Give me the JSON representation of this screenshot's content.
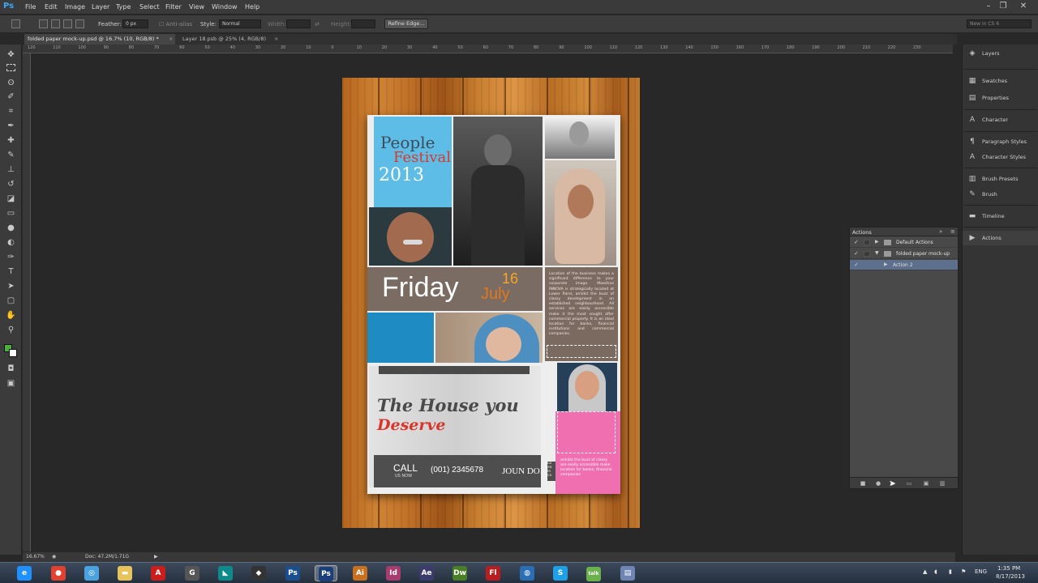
{
  "app": {
    "logo": "Ps"
  },
  "menubar": {
    "items": [
      "File",
      "Edit",
      "Image",
      "Layer",
      "Type",
      "Select",
      "Filter",
      "View",
      "Window",
      "Help"
    ],
    "window_controls": [
      "–",
      "❐",
      "✕"
    ]
  },
  "options_bar": {
    "feather_label": "Feather:",
    "feather_value": "0 px",
    "antialias_label": "Anti-alias",
    "style_label": "Style:",
    "style_value": "Normal",
    "width_label": "Width:",
    "height_label": "Height:",
    "refine_edge": "Refine Edge...",
    "workspace": "New in CS 6"
  },
  "tabs": [
    {
      "label": "folded paper mock-up.psd @ 16.7% (10, RGB/8) *",
      "active": true
    },
    {
      "label": "Layer 18.psb @ 25% (4, RGB/8)",
      "active": false
    }
  ],
  "ruler_h": [
    "120",
    "110",
    "100",
    "90",
    "80",
    "70",
    "60",
    "50",
    "40",
    "30",
    "20",
    "10",
    "0",
    "10",
    "20",
    "30",
    "40",
    "50",
    "60",
    "70",
    "80",
    "90",
    "100",
    "110",
    "120",
    "130",
    "140",
    "150",
    "160",
    "170",
    "180",
    "190",
    "200",
    "210",
    "220",
    "230"
  ],
  "flyer": {
    "people": "People",
    "festival": "Festival",
    "year": "2013",
    "day": "Friday",
    "date_num": "16",
    "month": "July",
    "body_text": "Location of the business makes a significant difference to your corporate image. Maestros INNOVA is strategically located at Lower Parel, amidst the buzz of classy development in an established neighbourhood. All services are easily accessible make it the most sought after commercial property. It is an ideal location for banks, financial institutions and commercial companies.",
    "pink_text": "amidst the buzz of classy are easily accessible make location for banks, financial companies",
    "house_line1": "The House you",
    "house_line2": "Deserve",
    "call": "CALL",
    "call_sub": "US NOW",
    "phone": "(001) 2345678",
    "name": "JOUN DOE",
    "side_text": "Lo ea lo co"
  },
  "status": {
    "zoom": "16.67%",
    "doc": "Doc: 47.2M/1.71G"
  },
  "dock": [
    {
      "icon": "layers-icon",
      "glyph": "◈",
      "label": "Layers"
    },
    {
      "icon": "swatches-icon",
      "glyph": "▦",
      "label": "Swatches"
    },
    {
      "icon": "properties-icon",
      "glyph": "▤",
      "label": "Properties"
    },
    {
      "icon": "character-icon",
      "glyph": "A",
      "label": "Character"
    },
    {
      "icon": "paragraph-styles-icon",
      "glyph": "¶",
      "label": "Paragraph Styles"
    },
    {
      "icon": "character-styles-icon",
      "glyph": "A",
      "label": "Character Styles"
    },
    {
      "icon": "brush-presets-icon",
      "glyph": "▥",
      "label": "Brush Presets"
    },
    {
      "icon": "brush-icon",
      "glyph": "✎",
      "label": "Brush"
    },
    {
      "icon": "timeline-icon",
      "glyph": "▬",
      "label": "Timeline"
    },
    {
      "icon": "actions-icon",
      "glyph": "▶",
      "label": "Actions"
    }
  ],
  "actions_panel": {
    "title": "Actions",
    "rows": [
      {
        "label": "Default Actions",
        "kind": "set",
        "expanded": false
      },
      {
        "label": "folded paper mock-up",
        "kind": "set",
        "expanded": true
      },
      {
        "label": "Action 2",
        "kind": "action",
        "selected": true
      }
    ]
  },
  "taskbar": {
    "apps": [
      {
        "name": "ie-icon",
        "glyph": "e",
        "color": "#1e90ff"
      },
      {
        "name": "chrome-icon",
        "glyph": "●",
        "color": "#e4402f"
      },
      {
        "name": "safari-icon",
        "glyph": "◎",
        "color": "#4aa3df"
      },
      {
        "name": "explorer-icon",
        "glyph": "▬",
        "color": "#e8c25a"
      },
      {
        "name": "acrobat-icon",
        "glyph": "A",
        "color": "#cc1d1d"
      },
      {
        "name": "app-g-icon",
        "glyph": "G",
        "color": "#555555"
      },
      {
        "name": "app-teal-icon",
        "glyph": "◣",
        "color": "#0d8a8a"
      },
      {
        "name": "app-dark-icon",
        "glyph": "◆",
        "color": "#333333"
      },
      {
        "name": "photoshop-icon",
        "glyph": "Ps",
        "color": "#1a4f8f"
      },
      {
        "name": "photoshop-active-icon",
        "glyph": "Ps",
        "color": "#1a3f7a"
      },
      {
        "name": "illustrator-icon",
        "glyph": "Ai",
        "color": "#c8701e"
      },
      {
        "name": "indesign-icon",
        "glyph": "Id",
        "color": "#a83c6e"
      },
      {
        "name": "aftereffects-icon",
        "glyph": "Ae",
        "color": "#3b3b6e"
      },
      {
        "name": "dreamweaver-icon",
        "glyph": "Dw",
        "color": "#4a7f26"
      },
      {
        "name": "flash-icon",
        "glyph": "Fl",
        "color": "#b81e1e"
      },
      {
        "name": "network-icon",
        "glyph": "◍",
        "color": "#2a6fb5"
      },
      {
        "name": "skype-icon",
        "glyph": "S",
        "color": "#1ea0e6"
      },
      {
        "name": "talk-icon",
        "glyph": "talk",
        "color": "#6ab04c"
      },
      {
        "name": "notepad-icon",
        "glyph": "▤",
        "color": "#6f86b5"
      }
    ],
    "lang": "ENG",
    "time": "1:35 PM",
    "date": "8/17/2013"
  }
}
